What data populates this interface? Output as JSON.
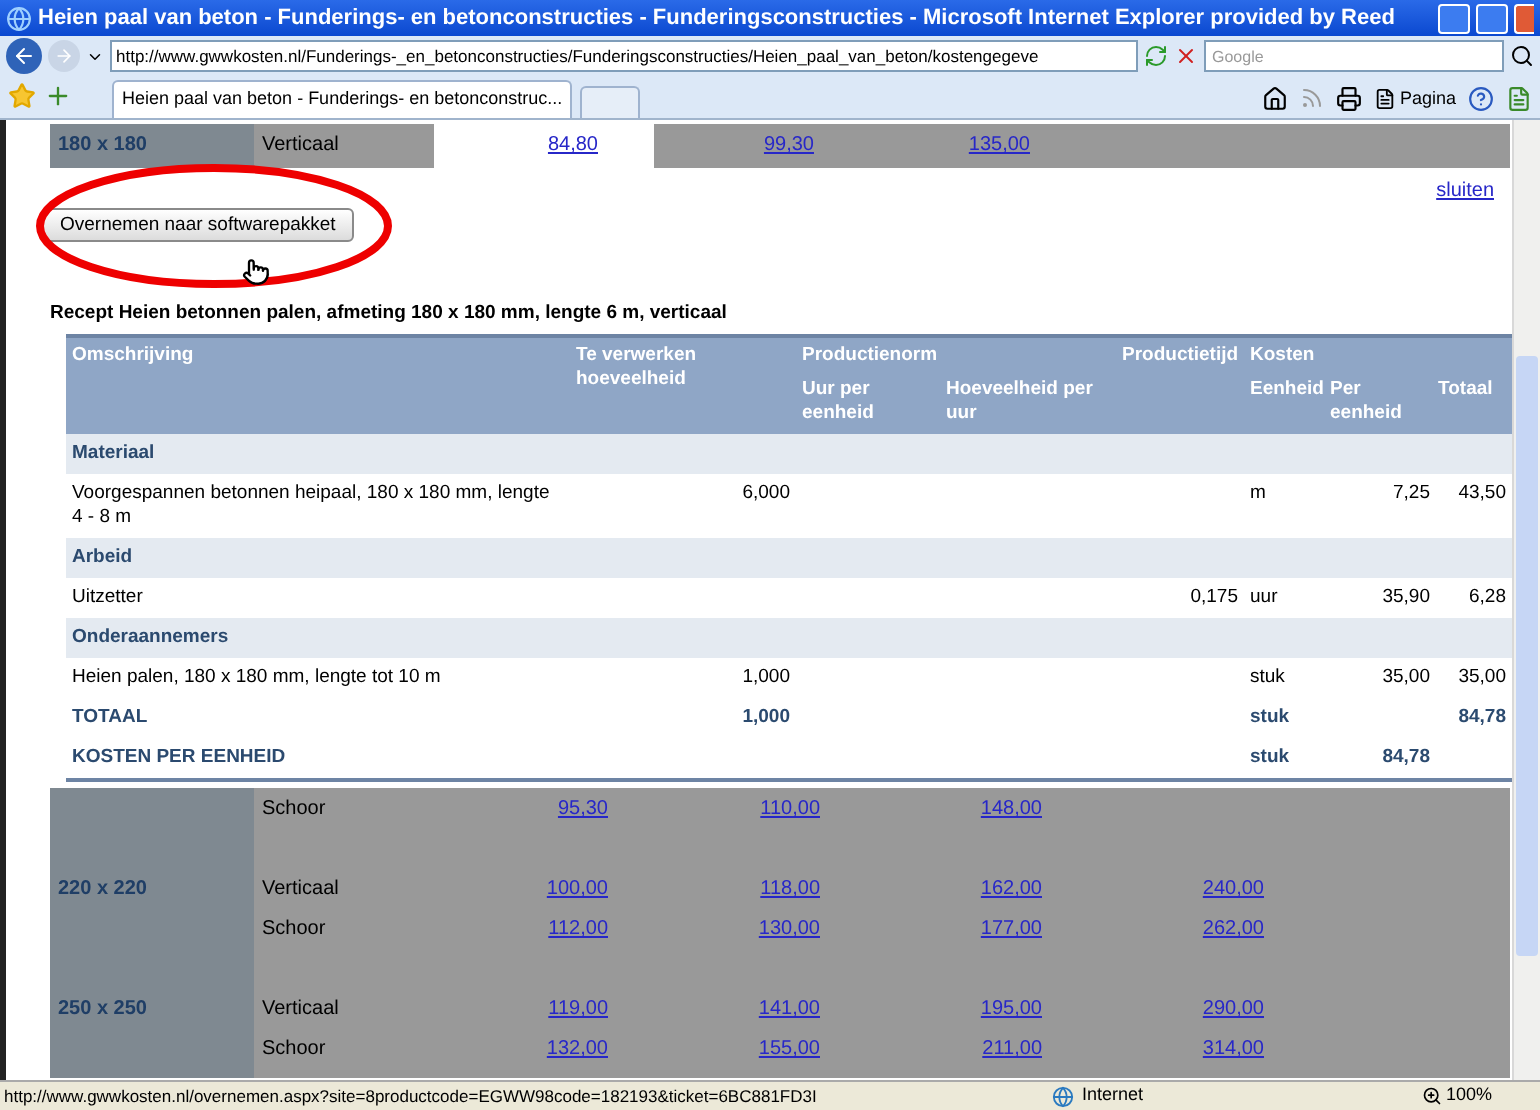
{
  "window": {
    "title": "Heien paal van beton - Funderings- en betonconstructies - Funderingsconstructies - Microsoft Internet Explorer provided by Reed"
  },
  "address_bar": {
    "url": "http://www.gwwkosten.nl/Funderings-_en_betonconstructies/Funderingsconstructies/Heien_paal_van_beton/kostengegeve"
  },
  "search": {
    "placeholder": "Google"
  },
  "tabs": [
    {
      "label": "Heien paal van beton - Funderings- en betonconstruc...",
      "selected": true
    }
  ],
  "command_bar": {
    "page_label": "Pagina"
  },
  "price_strip": {
    "size": "180 x 180",
    "orientation": "Verticaal",
    "values": [
      {
        "text": "84,80",
        "selected": true
      },
      {
        "text": "99,30",
        "selected": false
      },
      {
        "text": "135,00",
        "selected": false
      }
    ]
  },
  "detail_panel": {
    "close_link": "sluiten",
    "button": "Overnemen naar softwarepakket",
    "recipe_title": "Recept Heien betonnen palen, afmeting 180 x 180 mm, lengte 6 m, verticaal",
    "columns": {
      "description": "Omschrijving",
      "quantity": "Te verwerken hoeveelheid",
      "norm": "Productienorm",
      "hours_per_unit": "Uur per eenheid",
      "amount_per_hour": "Hoeveelheid per uur",
      "production_time": "Productietijd",
      "costs": "Kosten",
      "unit": "Eenheid",
      "per_unit": "Per eenheid",
      "total": "Totaal"
    },
    "rows": [
      {
        "kind": "section",
        "description": "Materiaal"
      },
      {
        "kind": "item",
        "description": "Voorgespannen betonnen heipaal, 180 x 180 mm, lengte 4 - 8 m",
        "quantity": "6,000",
        "unit": "m",
        "per_unit": "7,25",
        "total": "43,50"
      },
      {
        "kind": "section",
        "description": "Arbeid"
      },
      {
        "kind": "item",
        "description": "Uitzetter",
        "production_time": "0,175",
        "unit": "uur",
        "per_unit": "35,90",
        "total": "6,28"
      },
      {
        "kind": "section",
        "description": "Onderaannemers"
      },
      {
        "kind": "item",
        "description": "Heien palen, 180 x 180 mm, lengte tot 10 m",
        "quantity": "1,000",
        "unit": "stuk",
        "per_unit": "35,00",
        "total": "35,00"
      },
      {
        "kind": "total",
        "description": "TOTAAL",
        "quantity": "1,000",
        "unit": "stuk",
        "total": "84,78"
      },
      {
        "kind": "total",
        "description": "KOSTEN PER EENHEID",
        "unit": "stuk",
        "per_unit": "84,78"
      }
    ]
  },
  "price_table": {
    "groups": [
      {
        "rows": [
          {
            "orientation": "Schoor",
            "values": [
              "95,30",
              "110,00",
              "148,00"
            ]
          }
        ]
      },
      {
        "size": "220 x 220",
        "rows": [
          {
            "orientation": "Verticaal",
            "values": [
              "100,00",
              "118,00",
              "162,00",
              "240,00"
            ]
          },
          {
            "orientation": "Schoor",
            "values": [
              "112,00",
              "130,00",
              "177,00",
              "262,00"
            ]
          }
        ]
      },
      {
        "size": "250 x 250",
        "rows": [
          {
            "orientation": "Verticaal",
            "values": [
              "119,00",
              "141,00",
              "195,00",
              "290,00"
            ]
          },
          {
            "orientation": "Schoor",
            "values": [
              "132,00",
              "155,00",
              "211,00",
              "314,00"
            ]
          }
        ]
      }
    ]
  },
  "status_bar": {
    "url": "http://www.gwwkosten.nl/overnemen.aspx?site=8productcode=EGWW98code=182193&ticket=6BC881FD3I",
    "zone": "Internet",
    "zoom": "100%"
  }
}
